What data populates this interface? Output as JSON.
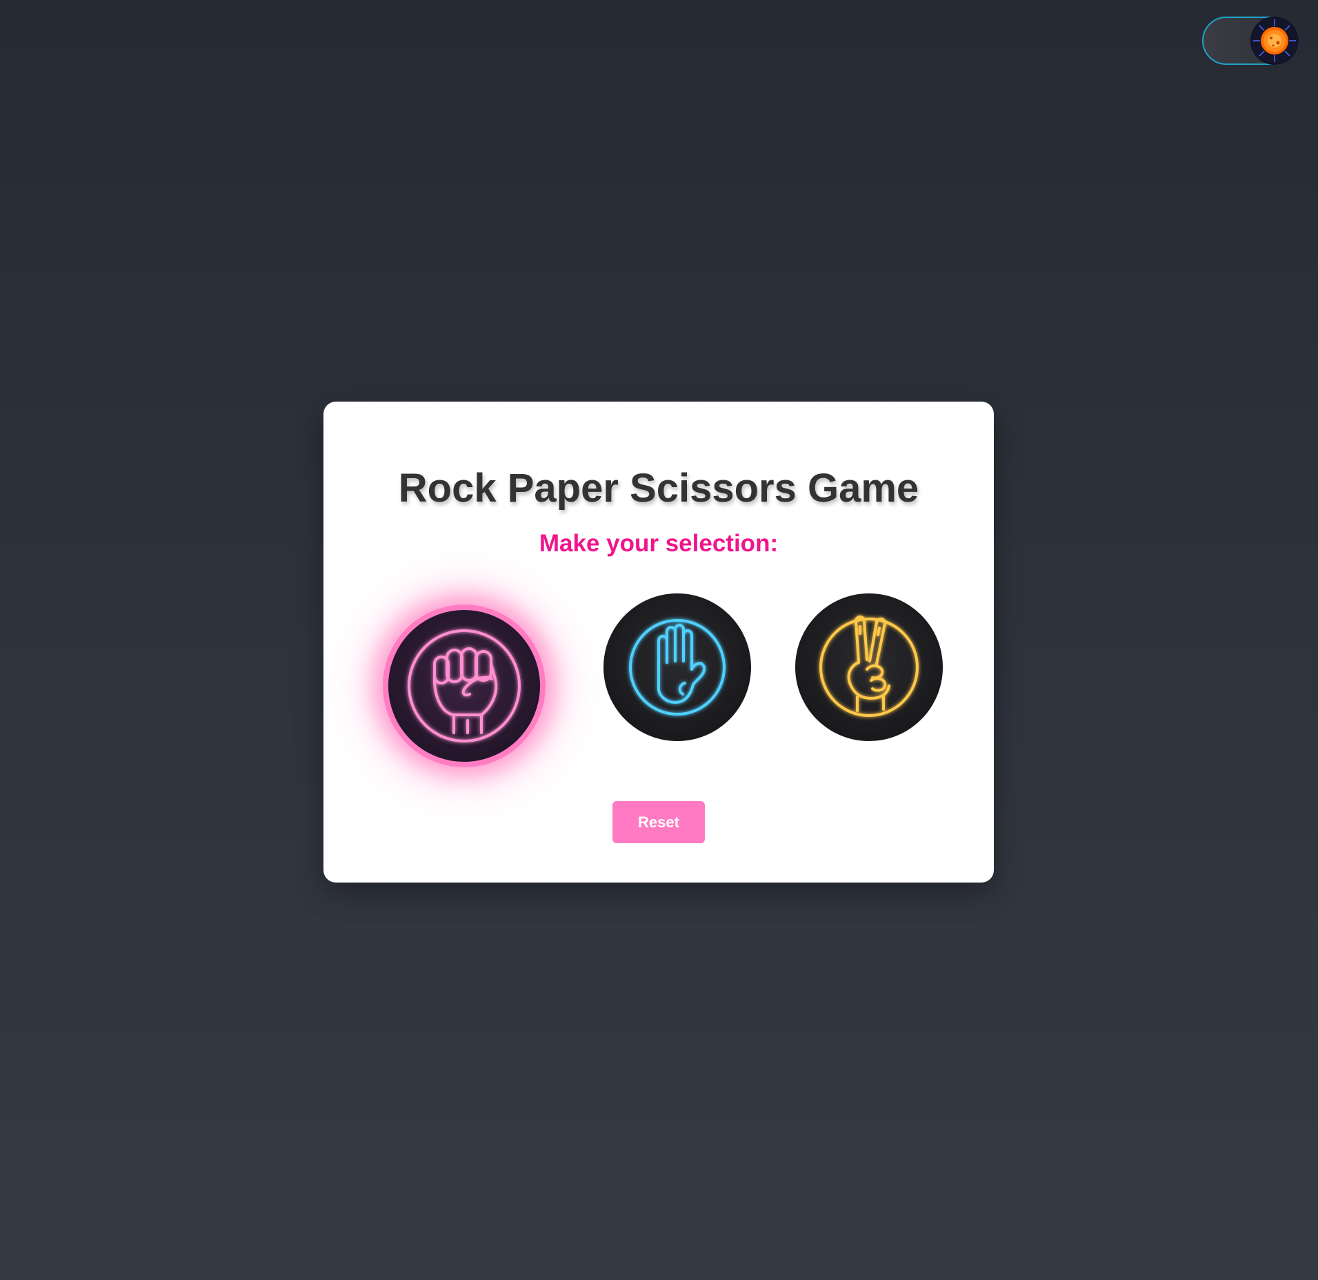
{
  "game": {
    "title": "Rock Paper Scissors Game",
    "prompt": "Make your selection:",
    "reset_label": "Reset",
    "selected_choice": "rock"
  },
  "choices": [
    {
      "name": "rock",
      "icon": "neon-fist-icon",
      "color": "#ff7cc3",
      "selected": true
    },
    {
      "name": "paper",
      "icon": "neon-open-hand-icon",
      "color": "#3fc4ff",
      "selected": false
    },
    {
      "name": "scissors",
      "icon": "neon-peace-hand-icon",
      "color": "#ffc233",
      "selected": false
    }
  ],
  "theme_toggle": {
    "icon": "sun-icon",
    "accent": "#1fa3c9"
  },
  "colors": {
    "accent": "#f0158c",
    "button": "#ff7ac2",
    "title": "#333333"
  }
}
